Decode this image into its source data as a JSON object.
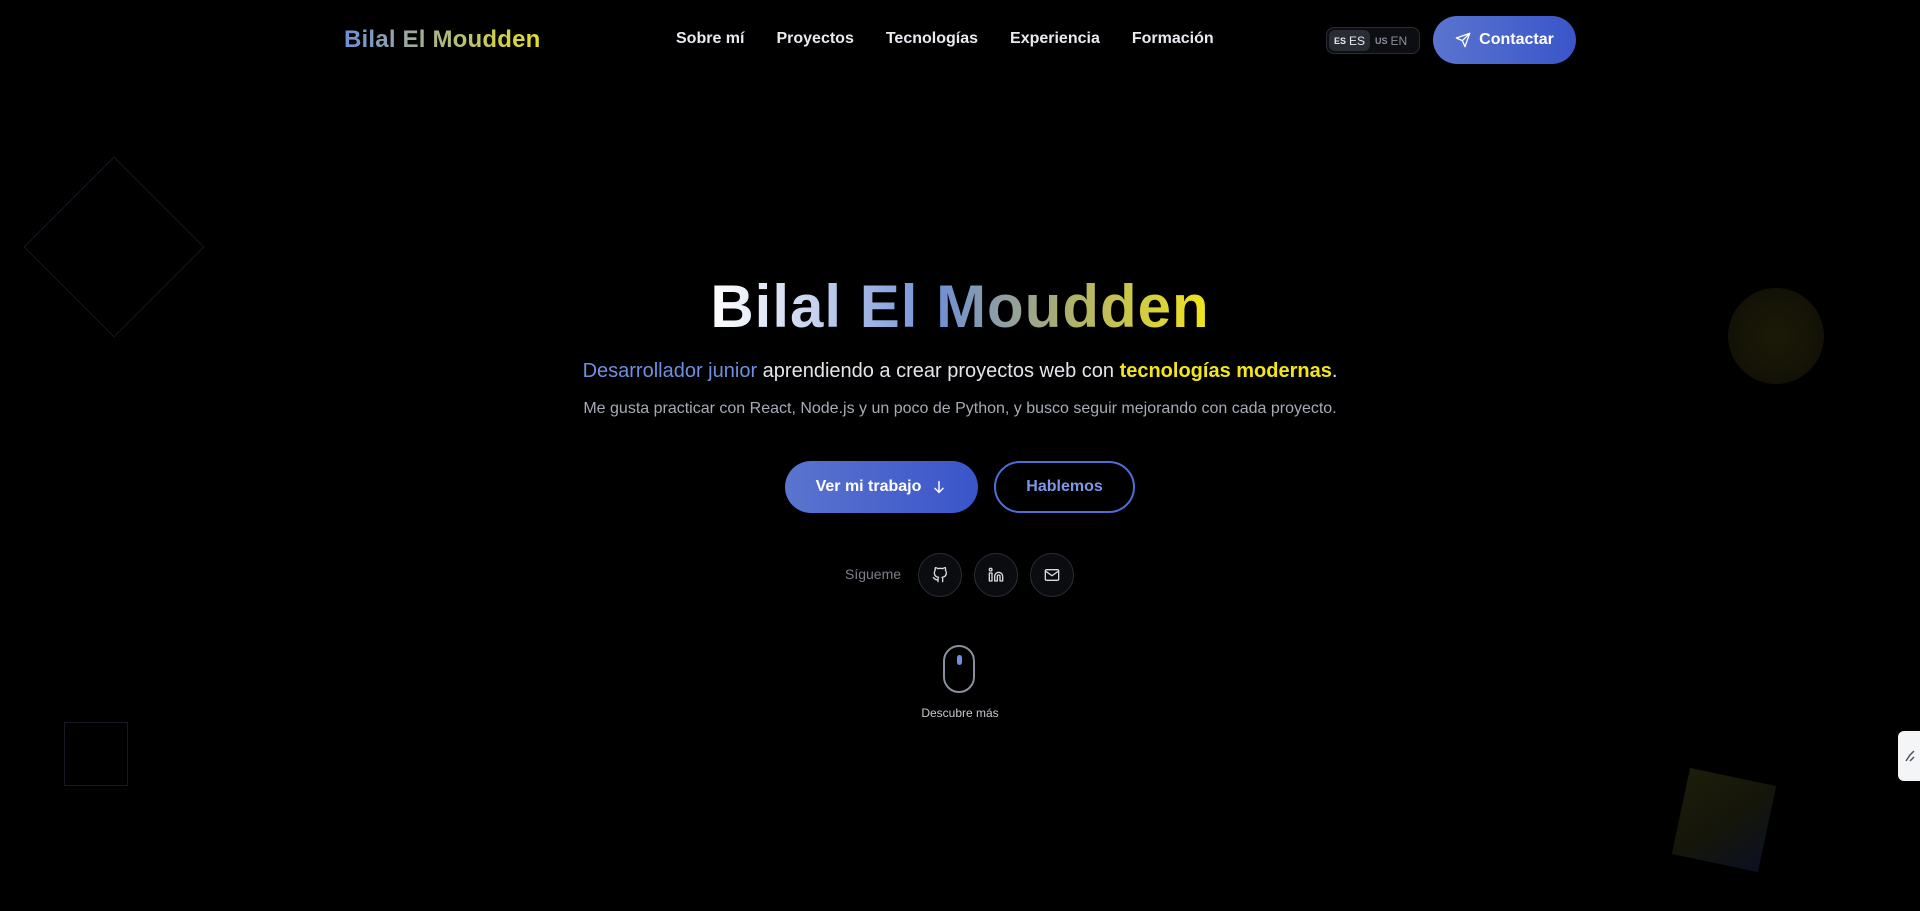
{
  "header": {
    "logo": "Bilal El Moudden",
    "nav": [
      "Sobre mí",
      "Proyectos",
      "Tecnologías",
      "Experiencia",
      "Formación"
    ],
    "lang": {
      "options": [
        {
          "flag": "ES",
          "code": "ES",
          "active": true
        },
        {
          "flag": "US",
          "code": "EN",
          "active": false
        }
      ]
    },
    "contact_label": "Contactar"
  },
  "hero": {
    "title": "Bilal El Moudden",
    "tagline_blue": "Desarrollador junior",
    "tagline_mid": " aprendiendo a crear proyectos web con ",
    "tagline_yellow": "tecnologías modernas",
    "tagline_end": ".",
    "subtitle": "Me gusta practicar con React, Node.js y un poco de Python, y busco seguir mejorando con cada proyecto.",
    "primary_button": "Ver mi trabajo",
    "secondary_button": "Hablemos",
    "follow_label": "Sígueme",
    "socials": [
      "github-icon",
      "linkedin-icon",
      "mail-icon"
    ],
    "scroll_label": "Descubre más"
  },
  "colors": {
    "background": "#000000",
    "accent_blue": "#4f6fd8",
    "accent_yellow": "#f2e61a"
  }
}
